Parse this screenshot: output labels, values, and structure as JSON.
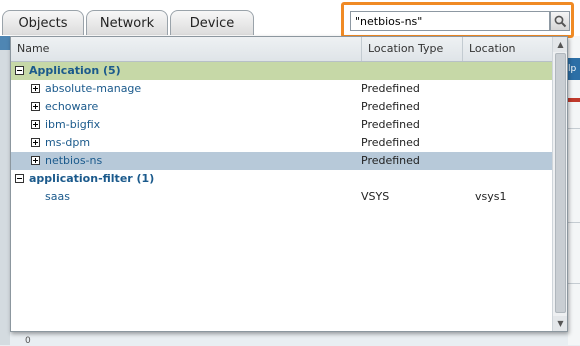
{
  "tabs": [
    "Objects",
    "Network",
    "Device"
  ],
  "search": {
    "value": "\"netbios-ns\""
  },
  "columns": {
    "name": "Name",
    "location_type": "Location Type",
    "location": "Location"
  },
  "groups": [
    {
      "label": "Application (5)",
      "items": [
        {
          "name": "absolute-manage",
          "location_type": "Predefined",
          "location": ""
        },
        {
          "name": "echoware",
          "location_type": "Predefined",
          "location": ""
        },
        {
          "name": "ibm-bigfix",
          "location_type": "Predefined",
          "location": ""
        },
        {
          "name": "ms-dpm",
          "location_type": "Predefined",
          "location": ""
        },
        {
          "name": "netbios-ns",
          "location_type": "Predefined",
          "location": ""
        }
      ]
    },
    {
      "label": "application-filter (1)",
      "items": [
        {
          "name": "saas",
          "location_type": "VSYS",
          "location": "vsys1"
        }
      ]
    }
  ],
  "selected_item": "netbios-ns",
  "background": {
    "right_label": "lp",
    "bottom_value": "0"
  },
  "colors": {
    "highlight": "#f08a24",
    "group_row": "#c6d8a7",
    "selected_row": "#b7c9d9",
    "link": "#1b5a8c"
  }
}
